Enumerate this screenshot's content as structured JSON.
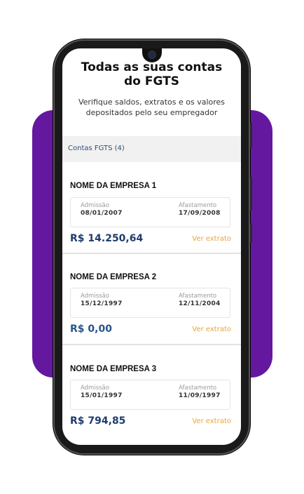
{
  "header": {
    "title_line1": "Todas as suas contas",
    "title_line2": "do FGTS",
    "subtitle_line1": "Verifique saldos, extratos e os valores",
    "subtitle_line2": "depositados pelo seu empregador"
  },
  "section": {
    "label": "Contas FGTS (4)"
  },
  "accounts": [
    {
      "name": "NOME DA EMPRESA 1",
      "admission_label": "Admissão",
      "admission": "08/01/2007",
      "leave_label": "Afastamento",
      "leave": "17/09/2008",
      "balance": "R$ 14.250,64",
      "link": "Ver extrato"
    },
    {
      "name": "NOME DA EMPRESA 2",
      "admission_label": "Admissão",
      "admission": "15/12/1997",
      "leave_label": "Afastamento",
      "leave": "12/11/2004",
      "balance": "R$ 0,00",
      "link": "Ver extrato"
    },
    {
      "name": "NOME DA EMPRESA 3",
      "admission_label": "Admissão",
      "admission": "15/01/1997",
      "leave_label": "Afastamento",
      "leave": "11/09/1997",
      "balance": "R$ 794,85",
      "link": "Ver extrato"
    }
  ],
  "colors": {
    "brand_purple": "#6418a0",
    "amount_navy": "#1f3c6e",
    "link_orange": "#e8a53a"
  }
}
